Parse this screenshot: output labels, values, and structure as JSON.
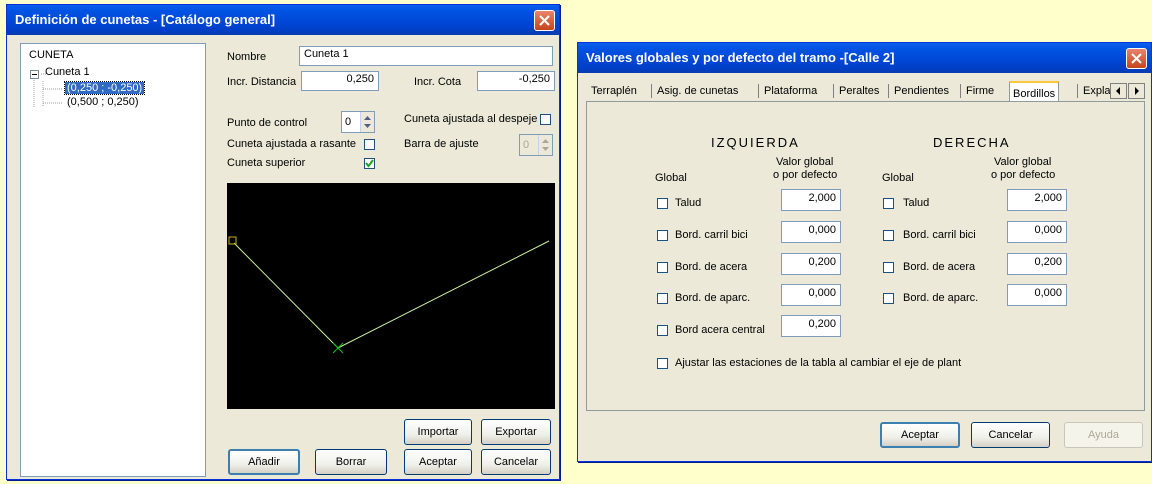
{
  "left_window": {
    "title": "Definición de cunetas - [Catálogo general]",
    "tree": {
      "root": "CUNETA",
      "node": "Cuneta 1",
      "points": [
        "(0,250 ; -0,250)",
        "(0,500 ; 0,250)"
      ]
    },
    "nombre_label": "Nombre",
    "nombre_value": "Cuneta 1",
    "incr_distancia_label": "Incr. Distancia",
    "incr_distancia_value": "0,250",
    "incr_cota_label": "Incr. Cota",
    "incr_cota_value": "-0,250",
    "punto_control_label": "Punto de control",
    "punto_control_value": "0",
    "cuneta_despeje_label": "Cuneta ajustada al despeje",
    "cuneta_rasante_label": "Cuneta ajustada a rasante",
    "barra_ajuste_label": "Barra de ajuste",
    "barra_ajuste_value": "0",
    "cuneta_superior_label": "Cuneta superior",
    "importar_label": "Importar",
    "exportar_label": "Exportar",
    "anadir_label": "Añadir",
    "borrar_label": "Borrar",
    "aceptar_label": "Aceptar",
    "cancelar_label": "Cancelar"
  },
  "right_window": {
    "title": "Valores globales y por defecto del tramo -[Calle 2]",
    "tabs": [
      "Terraplén",
      "Asig. de cunetas",
      "Plataforma",
      "Peraltes",
      "Pendientes",
      "Firme",
      "Bordillos",
      "Explar"
    ],
    "active_tab": "Bordillos",
    "izquierda_heading": "IZQUIERDA",
    "derecha_heading": "DERECHA",
    "global_label": "Global",
    "valor_global_label_1": "Valor global",
    "valor_global_label_2": "o por defecto",
    "rows": [
      {
        "label": "Talud",
        "left_value": "2,000",
        "right_value": "2,000"
      },
      {
        "label": "Bord. carril bici",
        "left_value": "0,000",
        "right_value": "0,000"
      },
      {
        "label": "Bord. de acera",
        "left_value": "0,200",
        "right_value": "0,200"
      },
      {
        "label": "Bord. de aparc.",
        "left_value": "0,000",
        "right_value": "0,000"
      }
    ],
    "bord_acera_central_label": "Bord acera central",
    "bord_acera_central_value": "0,200",
    "ajustar_label": "Ajustar las estaciones de la tabla al cambiar el eje de plant",
    "aceptar_label": "Aceptar",
    "cancelar_label": "Cancelar",
    "ayuda_label": "Ayuda"
  },
  "colors": {
    "background": "#FFFFCC",
    "titlebar": "#0054E3",
    "window_face": "#ECE9D8",
    "preview_background": "#000000",
    "preview_line": "#C8F0A0",
    "control_point_marker": "#C8B400",
    "low_point_marker": "#00C800"
  }
}
